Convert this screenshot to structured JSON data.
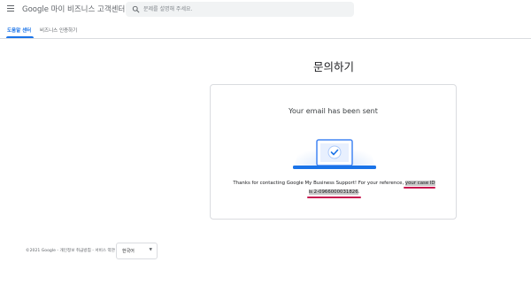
{
  "header": {
    "app_title": "Google 마이 비즈니스 고객센터",
    "menu_icon": "hamburger-menu-icon",
    "search": {
      "placeholder": "문제를 설명해 주세요.",
      "icon": "search-icon"
    }
  },
  "tabs": [
    {
      "label": "도움말 센터",
      "active": true
    },
    {
      "label": "비즈니스 인증하기",
      "active": false
    }
  ],
  "main": {
    "page_title": "문의하기",
    "card": {
      "title": "Your email has been sent",
      "illustration_icon": "laptop-checkmark-icon",
      "message_prefix": "Thanks for contacting Google My Business Support! For your reference,",
      "message_highlight_1": "your case ID",
      "message_highlight_2": "is 2-0966000031826",
      "message_suffix": "."
    }
  },
  "footer": {
    "legal_text": "©2021 Google - 개인정보 취급방침 - 서비스 약관",
    "language": {
      "selected": "한국어",
      "icon": "dropdown-arrow-icon"
    }
  },
  "colors": {
    "accent": "#1a73e8",
    "annotation_underline": "#c8174f",
    "highlight": "#c8c8c8",
    "laptop_screen": "#e8f0fe",
    "laptop_base": "#1a73e8"
  }
}
